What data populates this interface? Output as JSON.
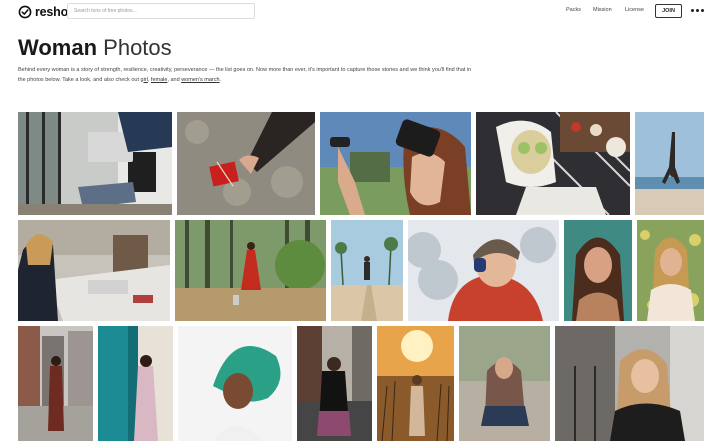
{
  "brand": {
    "name": "reshot"
  },
  "search": {
    "placeholder": "Search tons of free photos..."
  },
  "nav": {
    "packs": "Packs",
    "mission": "Mission",
    "license": "License",
    "join": "JOIN"
  },
  "page": {
    "title_bold": "Woman",
    "title_light": " Photos",
    "description": "Behind every woman is a story of strength, resilience, creativity, perseverance — the list goes on. Now more than ever, it's important to capture those stories and we think you'll find that in the photos below. Take a look, and also check out ",
    "link_girl": "girl",
    "sep1": ", ",
    "link_female": "female",
    "sep2": ", and ",
    "link_womens_march": "women's march",
    "end": "."
  },
  "colors": {
    "accent": "#222222",
    "link": "#333333"
  },
  "photos": [
    {
      "name": "photo-woman-laptop-window",
      "subject": "woman with laptop by window"
    },
    {
      "name": "photo-hand-gift-box",
      "subject": "hand holding red gift box"
    },
    {
      "name": "photo-woman-vr-headset",
      "subject": "woman wearing VR headset"
    },
    {
      "name": "photo-woman-face-mask",
      "subject": "woman with face mask and cucumbers"
    },
    {
      "name": "photo-beach-yoga",
      "subject": "woman doing handstand on beach"
    },
    {
      "name": "photo-woman-office-desk",
      "subject": "woman working at office desk"
    },
    {
      "name": "photo-woman-red-dress-forest",
      "subject": "woman in red dress in forest"
    },
    {
      "name": "photo-woman-palm-road",
      "subject": "woman walking on palm road"
    },
    {
      "name": "photo-woman-winter-hat",
      "subject": "woman in winter hat and red jacket"
    },
    {
      "name": "photo-woman-portrait-teal",
      "subject": "portrait of woman"
    },
    {
      "name": "photo-woman-flowers",
      "subject": "woman with flowers"
    },
    {
      "name": "photo-woman-city-street",
      "subject": "woman in city street"
    },
    {
      "name": "photo-woman-teal-wall",
      "subject": "woman leaning on teal wall"
    },
    {
      "name": "photo-woman-teal-hair",
      "subject": "woman with teal curly hair"
    },
    {
      "name": "photo-woman-downtown",
      "subject": "woman on downtown street"
    },
    {
      "name": "photo-woman-sunset-field",
      "subject": "woman in field at sunset"
    },
    {
      "name": "photo-woman-crouching-park",
      "subject": "woman crouching in park"
    },
    {
      "name": "photo-woman-cafe-chair",
      "subject": "woman sitting in cafe"
    }
  ]
}
